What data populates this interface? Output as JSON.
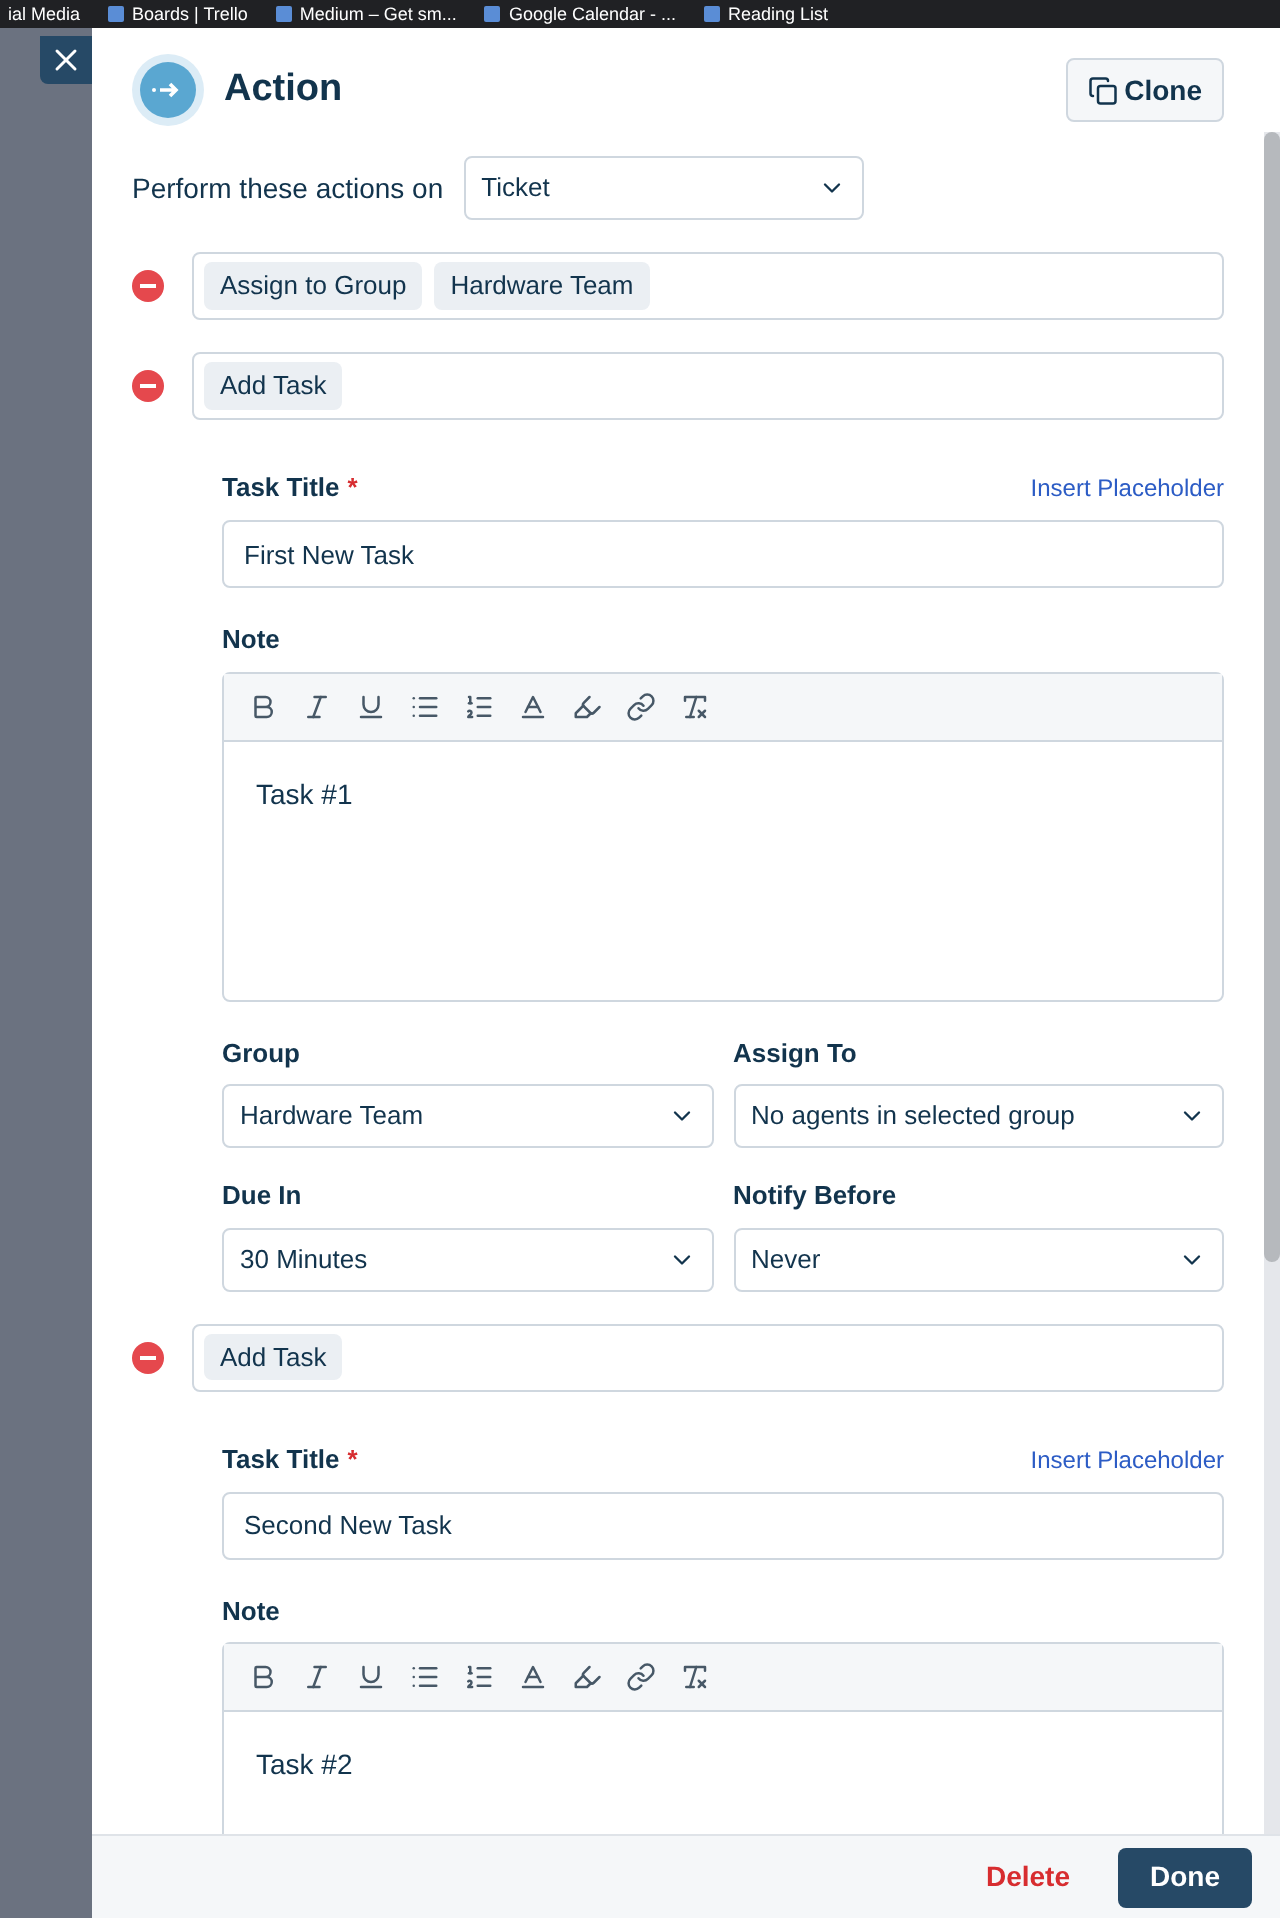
{
  "bookmarks": [
    "ial Media",
    "Boards | Trello",
    "Medium – Get sm...",
    "Google Calendar - ...",
    "Reading List"
  ],
  "header": {
    "title": "Action",
    "clone": "Clone"
  },
  "target": {
    "label": "Perform these actions on",
    "value": "Ticket"
  },
  "actions": [
    {
      "kind": "assign",
      "chips": [
        "Assign to Group",
        "Hardware Team"
      ]
    },
    {
      "kind": "task",
      "chips": [
        "Add Task"
      ],
      "task": {
        "title_label": "Task Title",
        "required_mark": "*",
        "insert_placeholder": "Insert Placeholder",
        "title_value": "First New Task",
        "note_label": "Note",
        "note": "Task #1",
        "fields": [
          {
            "label": "Group",
            "value": "Hardware Team"
          },
          {
            "label": "Assign To",
            "value": "No agents in selected group"
          },
          {
            "label": "Due In",
            "value": "30 Minutes"
          },
          {
            "label": "Notify Before",
            "value": "Never"
          }
        ]
      }
    },
    {
      "kind": "task",
      "chips": [
        "Add Task"
      ],
      "task": {
        "title_label": "Task Title",
        "required_mark": "*",
        "insert_placeholder": "Insert Placeholder",
        "title_value": "Second New Task",
        "note_label": "Note",
        "note": "Task #2"
      }
    }
  ],
  "footer": {
    "delete": "Delete",
    "done": "Done"
  }
}
